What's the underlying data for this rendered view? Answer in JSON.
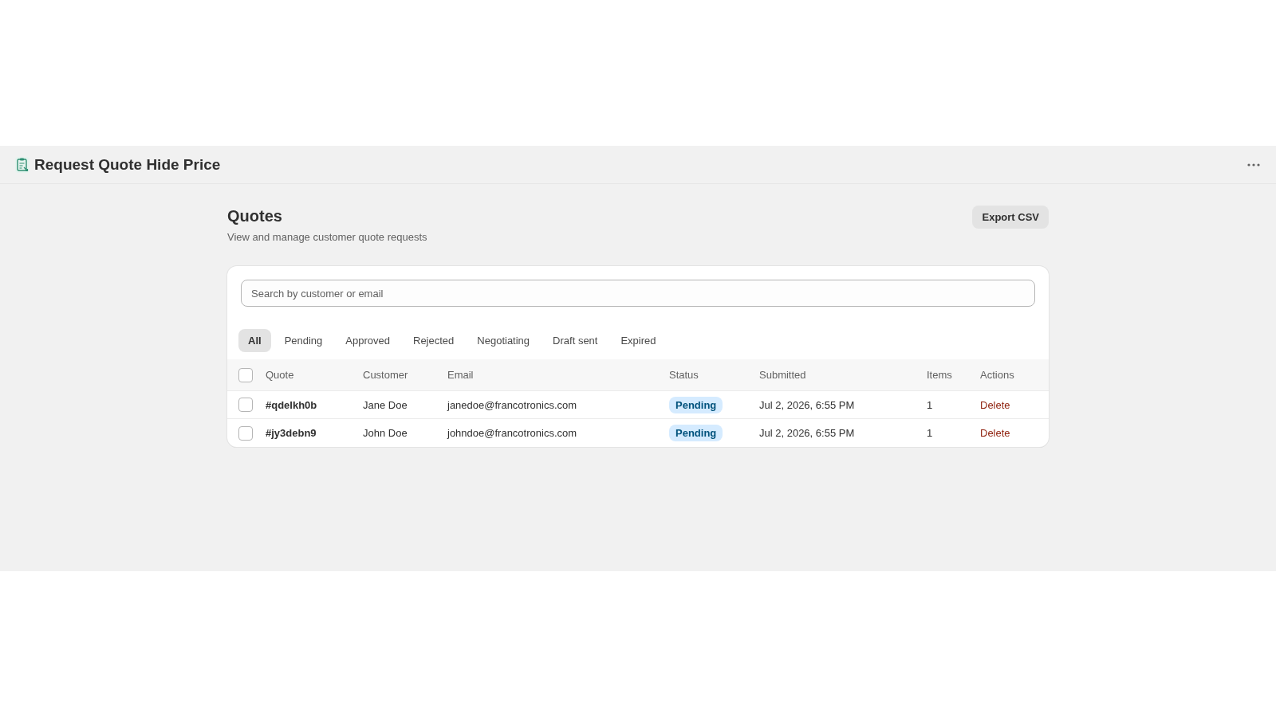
{
  "app": {
    "title": "Request Quote Hide Price"
  },
  "page": {
    "title": "Quotes",
    "subtitle": "View and manage customer quote requests",
    "export_button": "Export CSV"
  },
  "search": {
    "placeholder": "Search by customer or email"
  },
  "filters": [
    {
      "label": "All",
      "selected": true
    },
    {
      "label": "Pending",
      "selected": false
    },
    {
      "label": "Approved",
      "selected": false
    },
    {
      "label": "Rejected",
      "selected": false
    },
    {
      "label": "Negotiating",
      "selected": false
    },
    {
      "label": "Draft sent",
      "selected": false
    },
    {
      "label": "Expired",
      "selected": false
    }
  ],
  "table": {
    "select_all": {
      "checked": false
    },
    "columns": [
      "Quote",
      "Customer",
      "Email",
      "Status",
      "Submitted",
      "Items",
      "Actions"
    ],
    "rows": [
      {
        "checked": false,
        "quote": "#qdelkh0b",
        "customer": "Jane Doe",
        "email": "janedoe@francotronics.com",
        "status": {
          "label": "Pending",
          "kind": "pending"
        },
        "submitted": "Jul 2, 2026, 6:55 PM",
        "items": "1",
        "action": "Delete"
      },
      {
        "checked": false,
        "quote": "#jy3debn9",
        "customer": "John Doe",
        "email": "johndoe@francotronics.com",
        "status": {
          "label": "Pending",
          "kind": "pending"
        },
        "submitted": "Jul 2, 2026, 6:55 PM",
        "items": "1",
        "action": "Delete"
      }
    ]
  }
}
